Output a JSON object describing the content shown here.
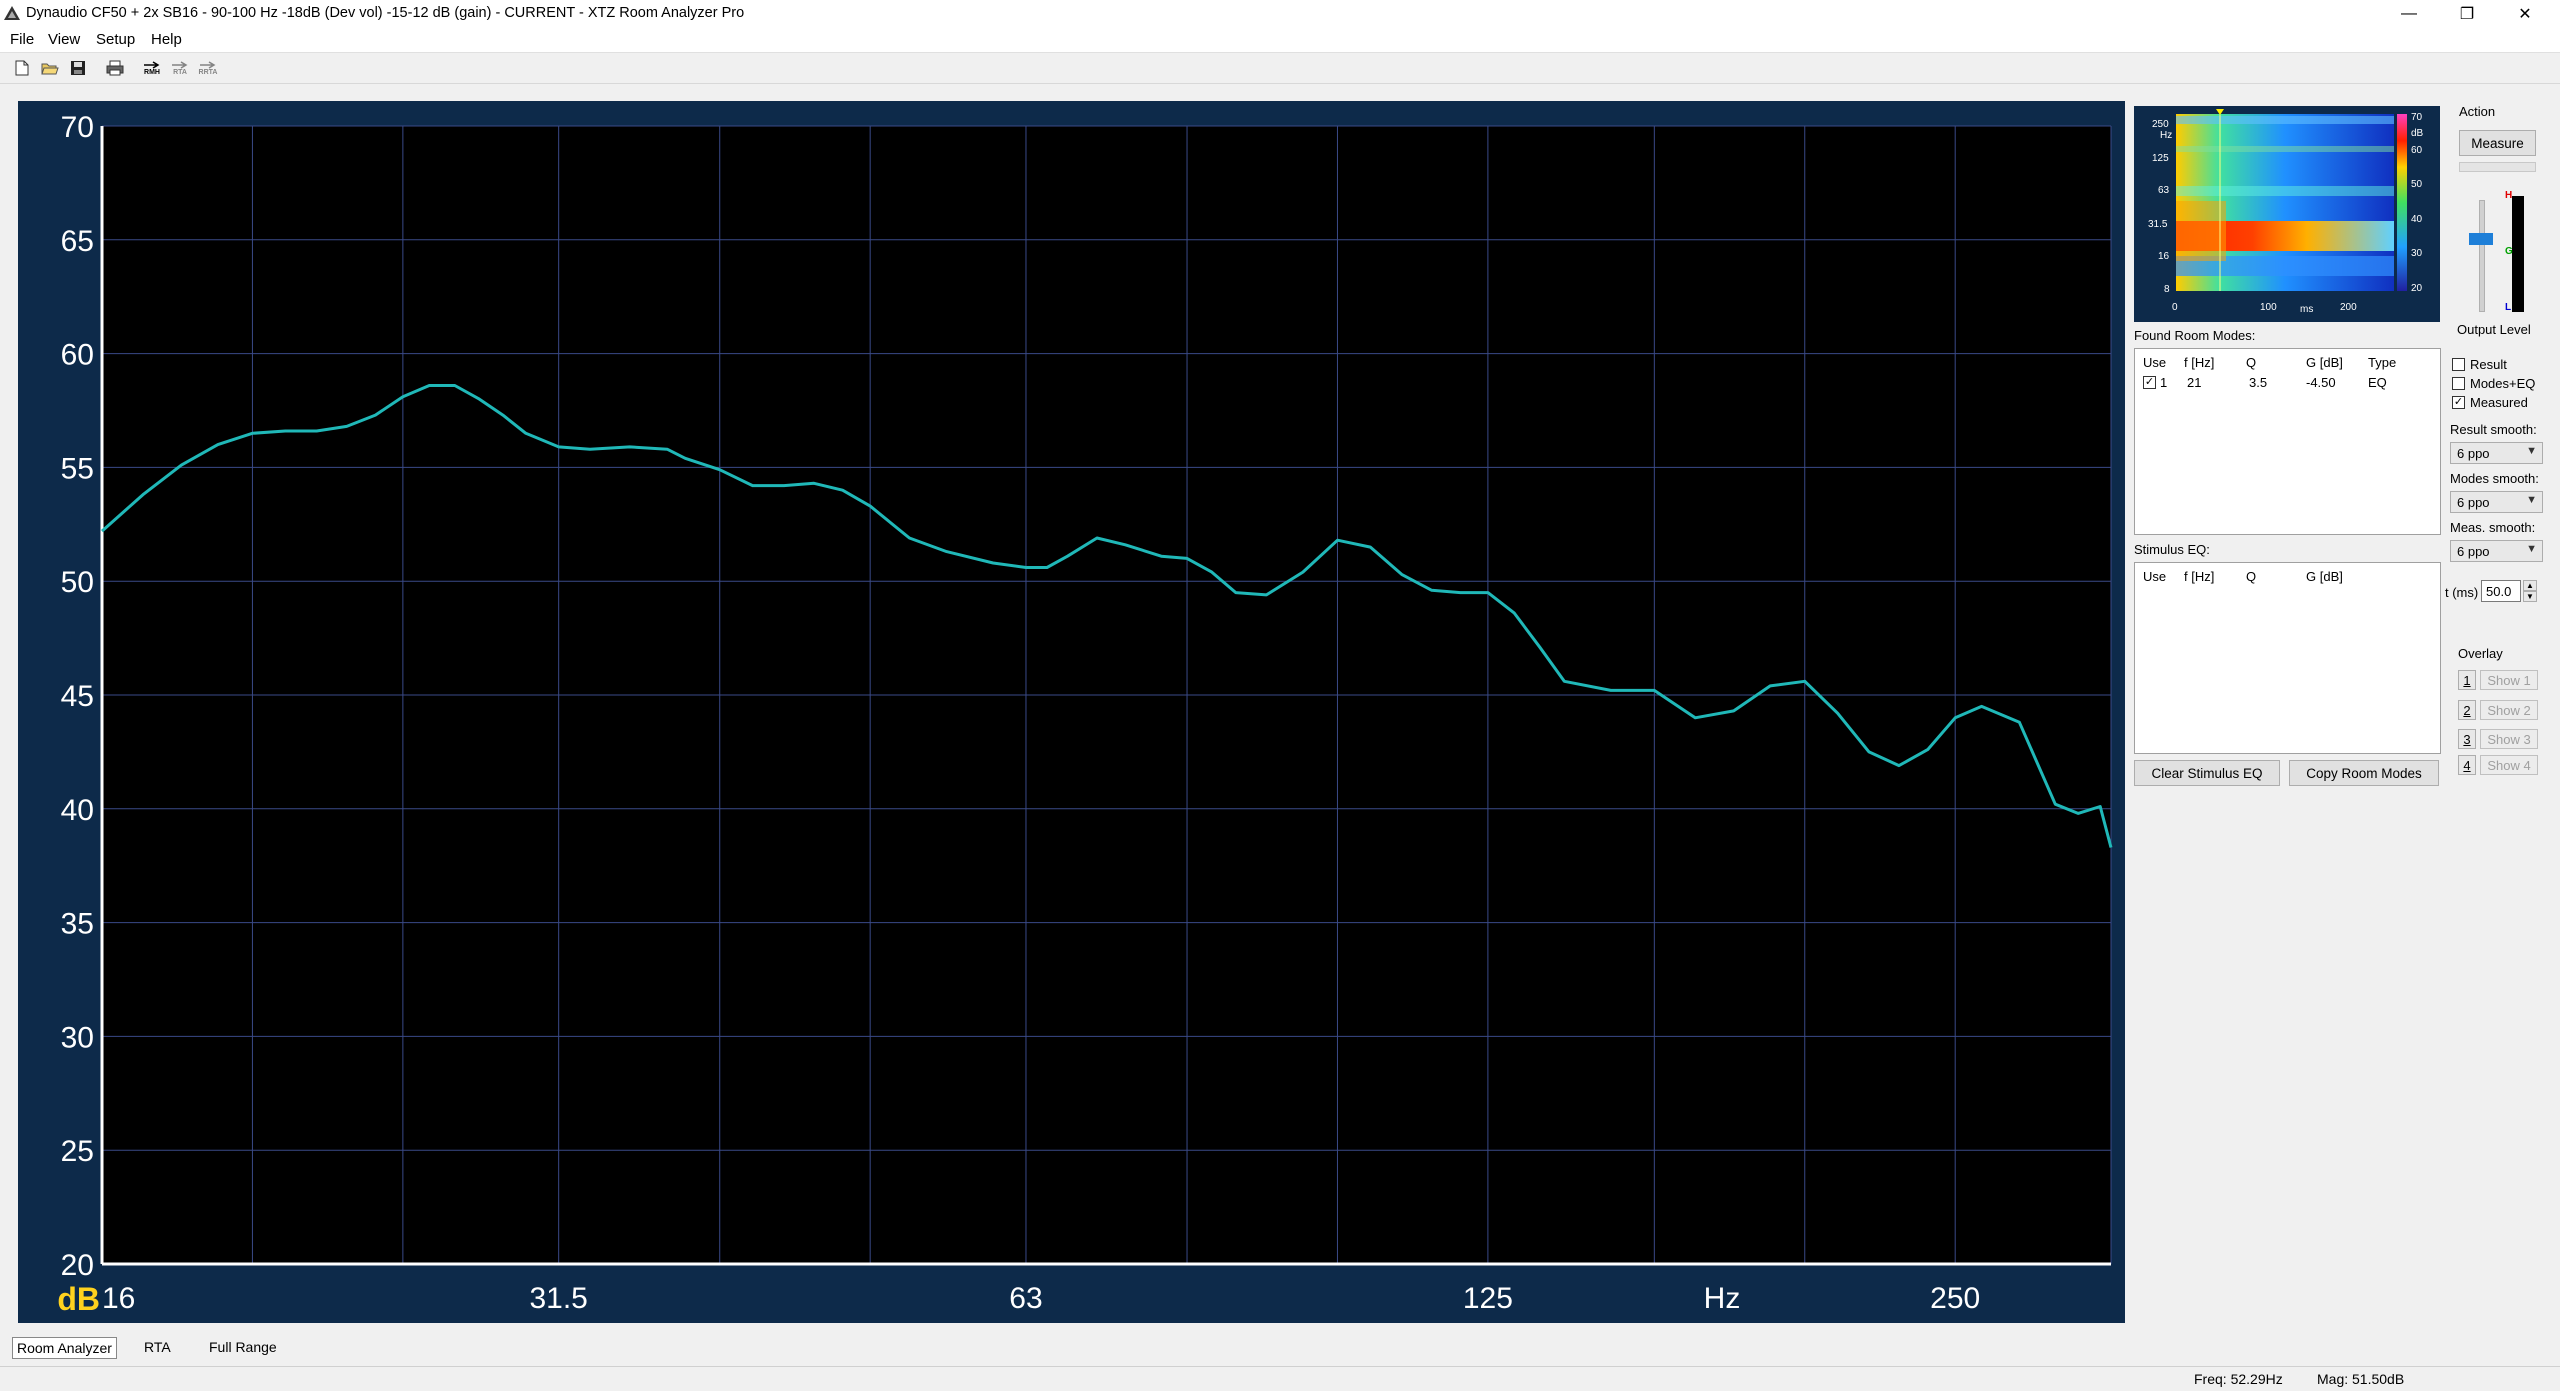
{
  "window": {
    "title": "Dynaudio CF50 + 2x SB16 - 90-100 Hz -18dB (Dev vol) -15-12 dB (gain) - CURRENT - XTZ Room Analyzer Pro",
    "minimize": "—",
    "maximize": "❐",
    "close": "✕"
  },
  "menu": [
    "File",
    "View",
    "Setup",
    "Help"
  ],
  "toolbar": {
    "buttons": [
      "new-icon",
      "open-icon",
      "save-icon",
      "print-icon",
      "rmh-icon",
      "rta-icon",
      "rrta-icon"
    ],
    "rmh_label": "RMH",
    "rta_label": "RTA",
    "rrta_label": "RRTA"
  },
  "chart_data": {
    "type": "line",
    "xlabel": "Hz",
    "ylabel": "dB",
    "x_scale": "log",
    "xlim": [
      16,
      315
    ],
    "ylim": [
      20,
      70
    ],
    "yticks": [
      70,
      65,
      60,
      55,
      50,
      45,
      40,
      35,
      30,
      25,
      20
    ],
    "xtick_labels": [
      {
        "value": 16,
        "label": "16"
      },
      {
        "value": 31.5,
        "label": "31.5"
      },
      {
        "value": 63,
        "label": "63"
      },
      {
        "value": 125,
        "label": "125"
      },
      {
        "value": 250,
        "label": "250"
      }
    ],
    "x_gridlines": [
      20,
      25,
      31.5,
      40,
      50,
      63,
      80,
      100,
      125,
      160,
      200,
      250,
      315
    ],
    "grid": true,
    "series": [
      {
        "color": "#20b8b8",
        "x": [
          16,
          17,
          18,
          19,
          20,
          21,
          22,
          23,
          24,
          25,
          26,
          27,
          28,
          29,
          30,
          31.5,
          33,
          35,
          37,
          38,
          40,
          42,
          44,
          46,
          48,
          50,
          53,
          56,
          60,
          63,
          65,
          67,
          70,
          73,
          77,
          80,
          83,
          86,
          90,
          95,
          100,
          105,
          110,
          115,
          120,
          125,
          130,
          135,
          140,
          150,
          160,
          170,
          180,
          190,
          200,
          210,
          220,
          230,
          240,
          250,
          260,
          275,
          290,
          300,
          310,
          315
        ],
        "values": [
          52.2,
          53.8,
          55.1,
          56.0,
          56.5,
          56.6,
          56.6,
          56.8,
          57.3,
          58.1,
          58.6,
          58.6,
          58.0,
          57.3,
          56.5,
          55.9,
          55.8,
          55.9,
          55.8,
          55.4,
          54.9,
          54.2,
          54.2,
          54.3,
          54.0,
          53.3,
          51.9,
          51.3,
          50.8,
          50.6,
          50.6,
          51.1,
          51.9,
          51.6,
          51.1,
          51.0,
          50.4,
          49.5,
          49.4,
          50.4,
          51.8,
          51.5,
          50.3,
          49.6,
          49.5,
          49.5,
          48.6,
          47.1,
          45.6,
          45.2,
          45.2,
          44.0,
          44.3,
          45.4,
          45.6,
          44.2,
          42.5,
          41.9,
          42.6,
          44.0,
          44.5,
          43.8,
          40.2,
          39.8,
          40.1,
          38.3
        ]
      }
    ]
  },
  "waterfall": {
    "y_labels": [
      "250",
      "Hz",
      "125",
      "63",
      "31.5",
      "16",
      "8"
    ],
    "x_labels": [
      "0",
      "100",
      "ms",
      "200"
    ],
    "scale_labels": [
      "70",
      "dB",
      "60",
      "50",
      "40",
      "30",
      "20"
    ]
  },
  "room_modes": {
    "label": "Found Room Modes:",
    "columns": [
      "Use",
      "f [Hz]",
      "Q",
      "G [dB]",
      "Type"
    ],
    "rows": [
      {
        "use": "1",
        "checked": true,
        "f": "21",
        "q": "3.5",
        "g": "-4.50",
        "type": "EQ"
      }
    ]
  },
  "stimulus_eq": {
    "label": "Stimulus EQ:",
    "columns": [
      "Use",
      "f [Hz]",
      "Q",
      "G [dB]"
    ]
  },
  "buttons": {
    "clear_stimulus": "Clear Stimulus EQ",
    "copy_modes": "Copy Room Modes"
  },
  "action": {
    "label": "Action",
    "measure": "Measure",
    "output_level": "Output Level",
    "meter_labels": [
      "H",
      "G",
      "L"
    ]
  },
  "display": {
    "options": [
      {
        "label": "Result",
        "checked": false
      },
      {
        "label": "Modes+EQ",
        "checked": false
      },
      {
        "label": "Measured",
        "checked": true
      }
    ],
    "result_smooth_label": "Result smooth:",
    "result_smooth": "6 ppo",
    "modes_smooth_label": "Modes smooth:",
    "modes_smooth": "6 ppo",
    "meas_smooth_label": "Meas. smooth:",
    "meas_smooth": "6 ppo",
    "t_label": "t (ms)",
    "t_value": "50.0"
  },
  "overlay": {
    "label": "Overlay",
    "items": [
      {
        "num": "1",
        "label": "Show 1"
      },
      {
        "num": "2",
        "label": "Show 2"
      },
      {
        "num": "3",
        "label": "Show 3"
      },
      {
        "num": "4",
        "label": "Show 4"
      }
    ]
  },
  "tabs": [
    "Room Analyzer",
    "RTA",
    "Full Range"
  ],
  "status": {
    "freq": "Freq: 52.29Hz",
    "mag": "Mag: 51.50dB"
  }
}
